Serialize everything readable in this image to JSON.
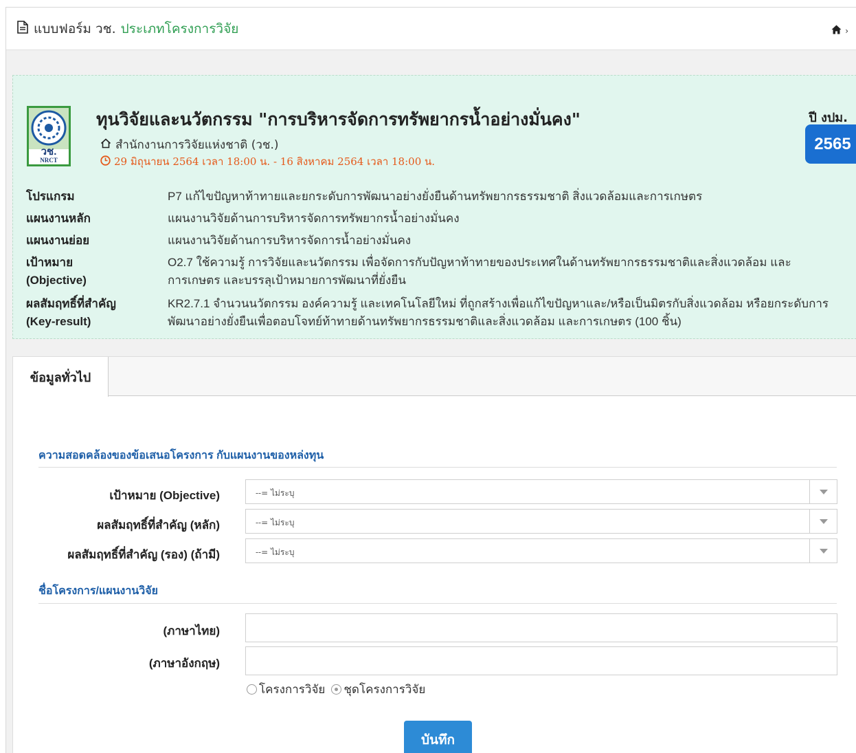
{
  "header": {
    "title_prefix": "แบบฟอร์ม วช.",
    "title_link": "ประเภทโครงการวิจัย"
  },
  "fund": {
    "title": "ทุนวิจัยและนวัตกรรม \"การบริหารจัดการทรัพยากรน้ำอย่างมั่นคง\"",
    "agency": "สำนักงานการวิจัยแห่งชาติ (วช.)",
    "dates": "29 มิถุนายน 2564 เวลา 18:00 น. - 16 สิงหาคม 2564 เวลา 18:00 น.",
    "year_label": "ปี งปม.",
    "year": "2565",
    "logo_text_thai": "วช.",
    "logo_text_en": "NRCT",
    "details": [
      {
        "key": "โปรแกรม",
        "value": "P7 แก้ไขปัญหาท้าทายและยกระดับการพัฒนาอย่างยั่งยืนด้านทรัพยากรธรรมชาติ สิ่งแวดล้อมและการเกษตร"
      },
      {
        "key": "แผนงานหลัก",
        "value": "แผนงานวิจัยด้านการบริหารจัดการทรัพยากรน้ำอย่างมั่นคง"
      },
      {
        "key": "แผนงานย่อย",
        "value": "แผนงานวิจัยด้านการบริหารจัดการน้ำอย่างมั่นคง"
      },
      {
        "key": "เป้าหมาย",
        "key2": "(Objective)",
        "value": "O2.7 ใช้ความรู้ การวิจัยและนวัตกรรม เพื่อจัดการกับปัญหาท้าทายของประเทศในด้านทรัพยากรธรรมชาติและสิ่งแวดล้อม และ",
        "value2": "การเกษตร และบรรลุเป้าหมายการพัฒนาที่ยั่งยืน"
      },
      {
        "key": "ผลสัมฤทธิ์ที่สำคัญ",
        "key2": "(Key-result)",
        "value": "KR2.7.1 จำนวนนวัตกรรม องค์ความรู้ และเทคโนโลยีใหม่ ที่ถูกสร้างเพื่อแก้ไขปัญหาและ/หรือเป็นมิตรกับสิ่งแวดล้อม หรือยกระดับการ",
        "value2": "พัฒนาอย่างยั่งยืนเพื่อตอบโจทย์ท้าทายด้านทรัพยากรธรรมชาติและสิ่งแวดล้อม และการเกษตร (100 ชิ้น)"
      }
    ]
  },
  "tabs": [
    {
      "label": "ข้อมูลทั่วไป"
    }
  ],
  "form": {
    "section1_title": "ความสอดคล้องของข้อเสนอโครงการ กับแผนงานของหล่งทุน",
    "objective_label": "เป้าหมาย (Objective)",
    "objective_value": "--= ไม่ระบุ",
    "kr_main_label": "ผลสัมฤทธิ์ที่สำคัญ (หลัก)",
    "kr_main_value": "--= ไม่ระบุ",
    "kr_sub_label": "ผลสัมฤทธิ์ที่สำคัญ (รอง) (ถ้ามี)",
    "kr_sub_value": "--= ไม่ระบุ",
    "section2_title": "ชื่อโครงการ/แผนงานวิจัย",
    "thai_label": "(ภาษาไทย)",
    "thai_value": "",
    "eng_label": "(ภาษาอังกฤษ)",
    "eng_value": "",
    "radio_options": [
      "โครงการวิจัย",
      "ชุดโครงการวิจัย"
    ],
    "radio_selected": "ชุดโครงการวิจัย",
    "save_label": "บันทึก"
  },
  "colors": {
    "accent_green": "#2f9e52",
    "info_bg": "#e1f6ee",
    "date_orange": "#e5591a",
    "year_blue": "#1a6fd1",
    "section_blue": "#1e5fa8",
    "button_blue": "#2d8bd6"
  },
  "icons": {
    "header": "document-icon",
    "home": "home-icon",
    "agency": "building-icon",
    "dates": "clock-icon",
    "dropdown": "caret-down-icon"
  }
}
